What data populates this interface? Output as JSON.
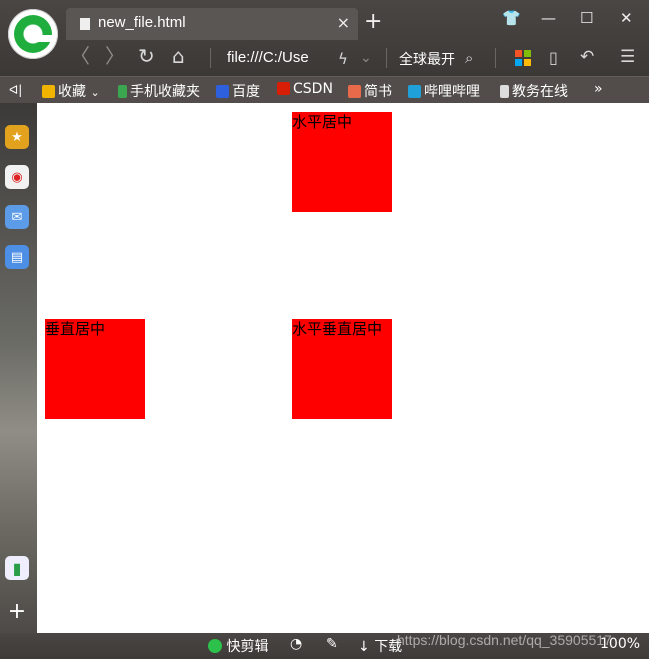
{
  "tab": {
    "title": "new_file.html",
    "close": "×"
  },
  "new_tab": "+",
  "window_buttons": {
    "skin": "👕",
    "minimize": "—",
    "maximize": "☐",
    "close": "✕"
  },
  "nav": {
    "back": "〈",
    "forward": "〉",
    "reload": "↻",
    "home": "⌂",
    "address": "file:///C:/Use",
    "flash": "ϟ",
    "dropdown": "⌄",
    "search_engine": "全球最开",
    "search_icon": "⌕",
    "undo": "↶",
    "menu": "☰"
  },
  "bookmarks": {
    "toggle": "ᐊ|",
    "items": [
      {
        "label": "收藏",
        "suffix": "⌄",
        "color": "#f0b400"
      },
      {
        "label": "手机收藏夹",
        "color": "#3aa64f"
      },
      {
        "label": "百度",
        "color": "#2e5fdc"
      },
      {
        "label": "CSDN",
        "color": "#d81e06"
      },
      {
        "label": "简书",
        "color": "#e96a4a"
      },
      {
        "label": "哔哩哔哩",
        "color": "#20a0d8"
      },
      {
        "label": "教务在线",
        "color": "#dddddd"
      }
    ],
    "more": "»"
  },
  "sidebar": {
    "items": [
      {
        "name": "favorites",
        "glyph": "★",
        "color": "#e2a21d"
      },
      {
        "name": "weibo",
        "glyph": "◉",
        "color": "#f2f2f2"
      },
      {
        "name": "mail",
        "glyph": "✉",
        "color": "#5c9be8"
      },
      {
        "name": "notes",
        "glyph": "▤",
        "color": "#4e8fe6"
      }
    ],
    "battery": "▮",
    "add": "+"
  },
  "boxes": [
    {
      "label": "水平居中"
    },
    {
      "label": "垂直居中"
    },
    {
      "label": "水平垂直居中"
    }
  ],
  "box_color": "#ff0000",
  "status": {
    "clip": "快剪辑",
    "download": "下载",
    "zoom": "100%"
  },
  "watermark": "https://blog.csdn.net/qq_35905517"
}
